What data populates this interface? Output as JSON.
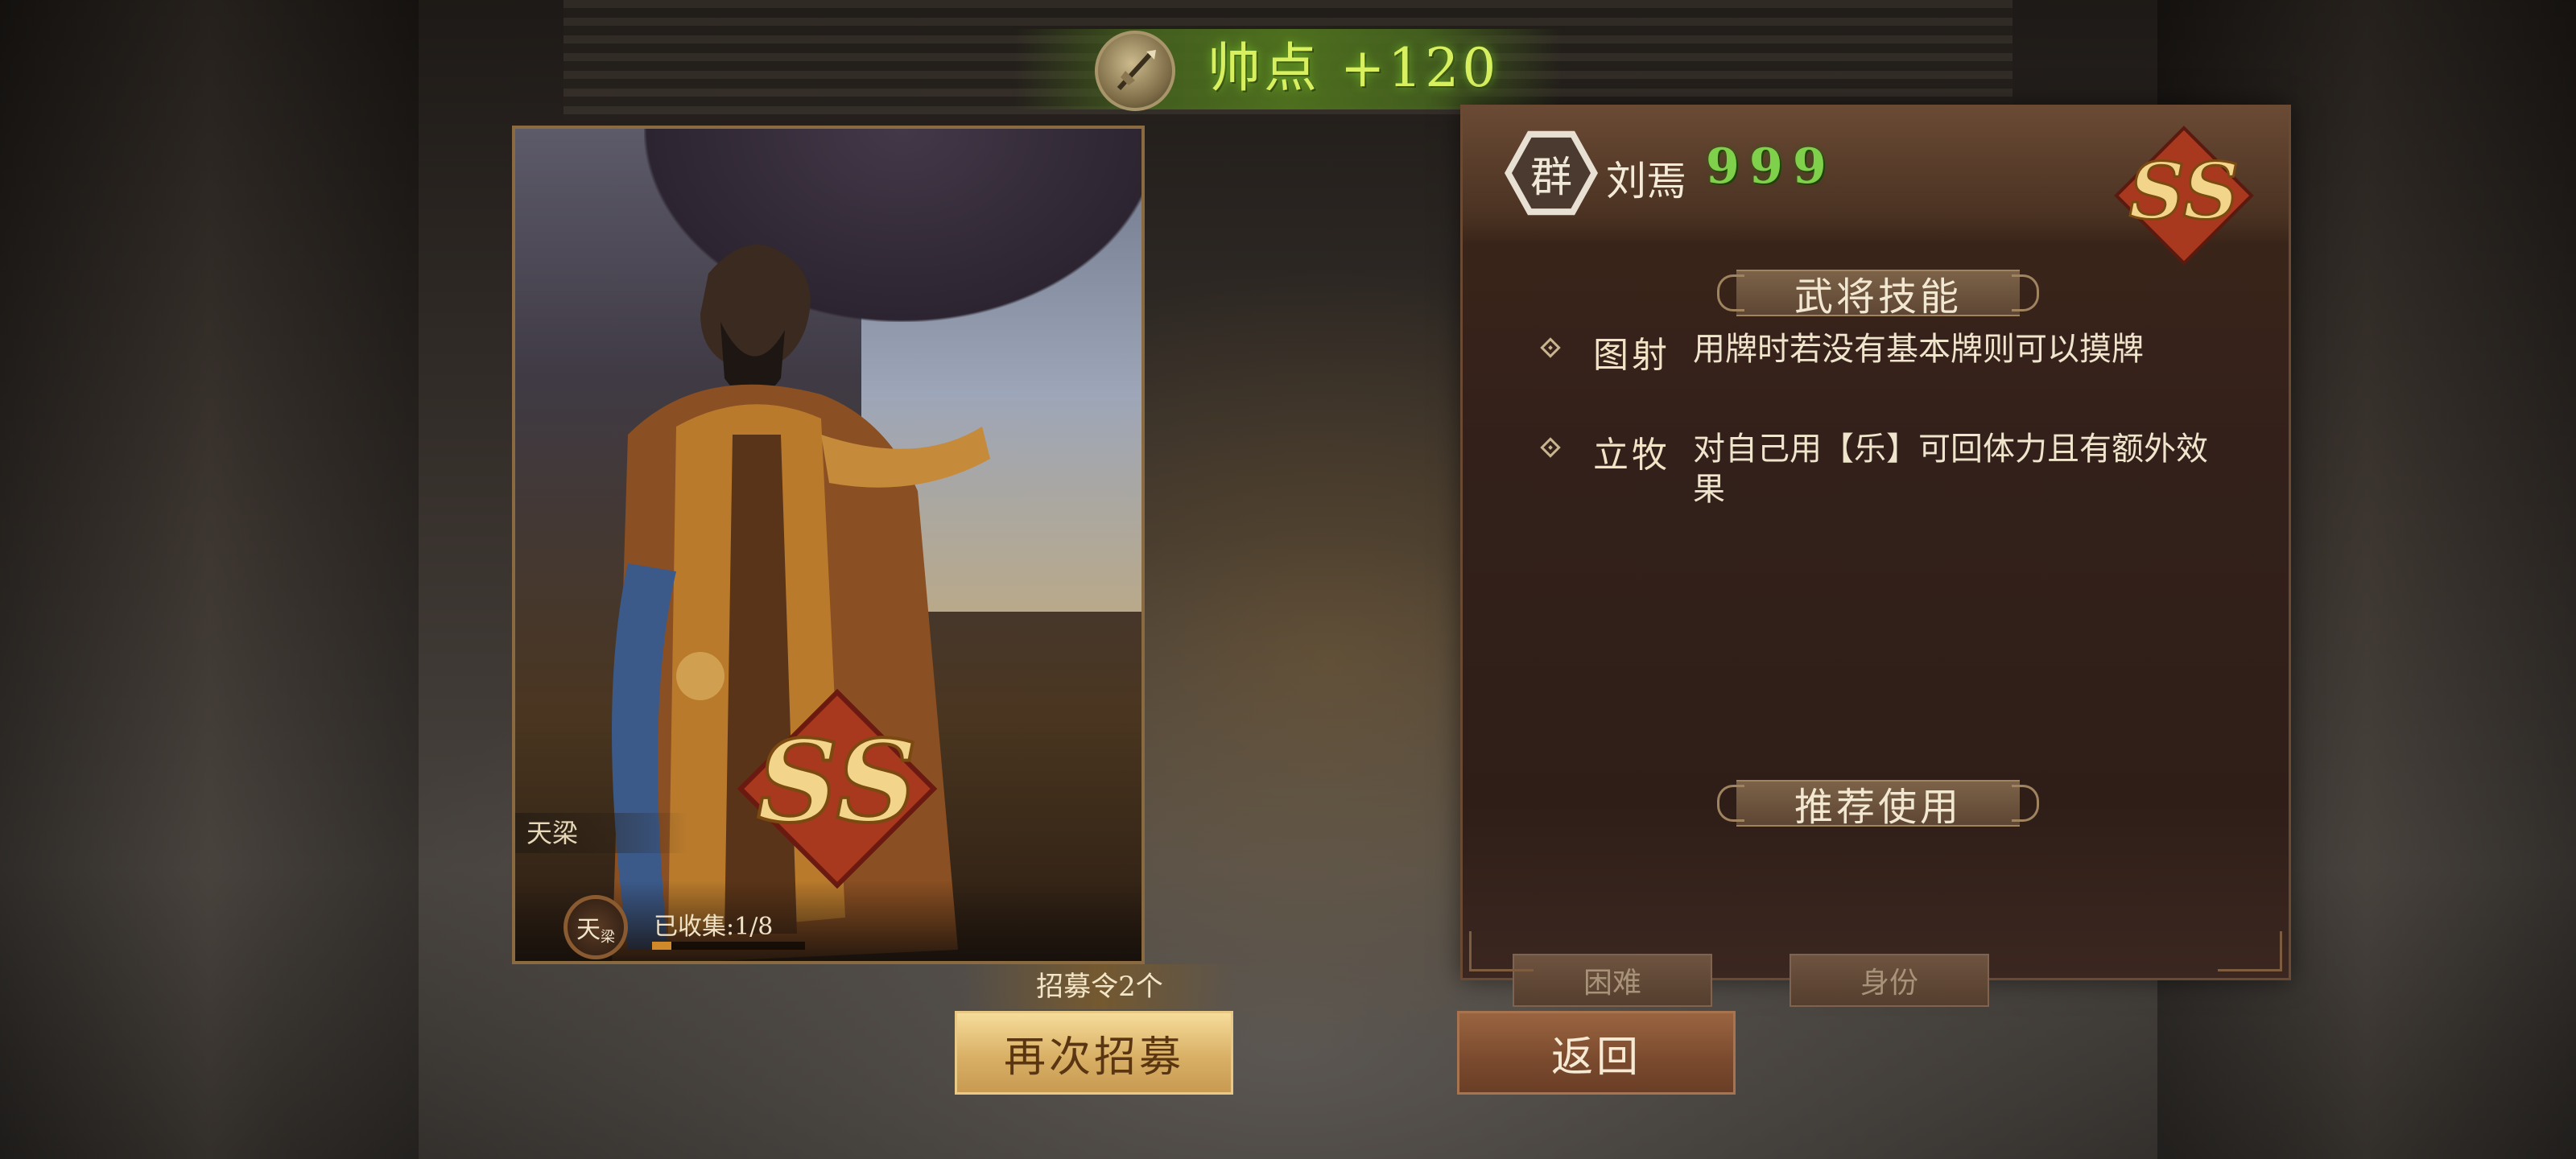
{
  "banner": {
    "text": "帅点 +120",
    "icon": "weapon-emblem-icon",
    "color": "#d8f060"
  },
  "card": {
    "skin_tag": "天梁",
    "collect_badge": "天",
    "collect_badge_sub": "梁",
    "collected_label": "已收集:1/8",
    "collected_progress": 0.125,
    "grade_icon": "ss-grade-icon"
  },
  "panel": {
    "faction": "群",
    "hero_name": "刘焉",
    "stars": [
      "9",
      "9",
      "9"
    ],
    "star_color": "#7fd04a",
    "grade_icon": "ss-grade-icon",
    "skills_title": "武将技能",
    "skills": [
      {
        "name": "图射",
        "desc": "用牌时若没有基本牌则可以摸牌"
      },
      {
        "name": "立牧",
        "desc": "对自己用【乐】可回体力且有额外效果"
      }
    ],
    "recommend_title": "推荐使用",
    "modes": [
      "困难",
      "身份"
    ]
  },
  "footer": {
    "tokens_label": "招募令2个",
    "again_label": "再次招募",
    "back_label": "返回"
  }
}
